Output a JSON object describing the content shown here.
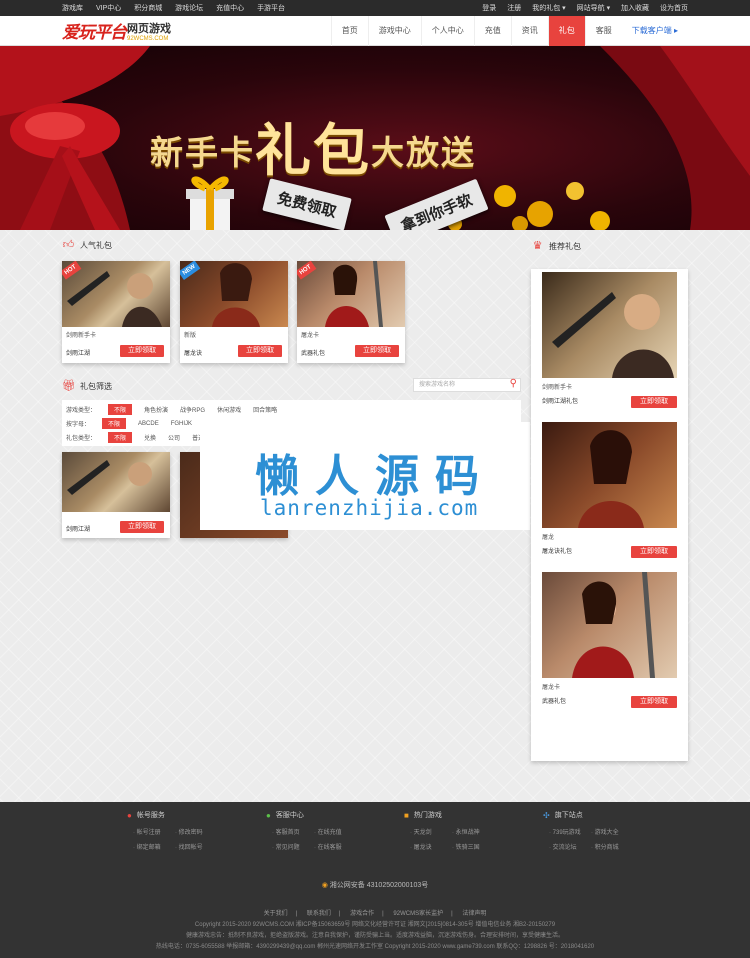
{
  "topbar": {
    "left": [
      "游戏库",
      "VIP中心",
      "积分商城",
      "游戏论坛",
      "充值中心",
      "手游平台"
    ],
    "right": [
      "登录",
      "注册",
      "我的礼包 ▾",
      "网站导航 ▾",
      "加入收藏",
      "设为首页"
    ]
  },
  "logo": {
    "main": "爱玩平台",
    "sub": "网页游戏",
    "domain": "92WCMS.COM"
  },
  "nav": {
    "items": [
      "首页",
      "游戏中心",
      "个人中心",
      "充值",
      "资讯",
      "礼包",
      "客服"
    ],
    "active_index": 5,
    "download": "下载客户端 ▸"
  },
  "banner": {
    "title_left": "新手卡",
    "title_big": "礼包",
    "title_right": "大放送",
    "tag1": "免费领取",
    "tag2": "拿到你手软"
  },
  "popular": {
    "title": "人气礼包",
    "cards": [
      {
        "badge": "HOT",
        "name": "剑雨新手卡",
        "sub": "剑雨江湖",
        "button": "立即领取"
      },
      {
        "badge": "NEW",
        "name": "新版",
        "sub": "屠龙诀",
        "button": "立即领取"
      },
      {
        "badge": "HOT",
        "name": "屠龙卡",
        "sub": "武器礼包",
        "button": "立即领取"
      }
    ]
  },
  "filter": {
    "title": "礼包筛选",
    "search_placeholder": "搜索游戏名称",
    "rows": [
      {
        "label": "游戏类型：",
        "options": [
          "不限",
          "角色扮演",
          "战争RPG",
          "休闲游戏",
          "回合策略"
        ]
      },
      {
        "label": "按字母：",
        "options": [
          "不限",
          "ABCDE",
          "FGHIJK"
        ]
      },
      {
        "label": "礼包类型：",
        "options": [
          "不限",
          "兑换",
          "公司",
          "普通"
        ]
      }
    ],
    "card": {
      "name": "剑雨江湖",
      "button": "立即领取"
    }
  },
  "recommend": {
    "title": "推荐礼包",
    "cards": [
      {
        "name": "剑雨新手卡",
        "sub": "剑雨江湖礼包",
        "button": "立即领取"
      },
      {
        "name": "屠龙",
        "sub": "屠龙诀礼包",
        "button": "立即领取"
      },
      {
        "name": "屠龙卡",
        "sub": "武器礼包",
        "button": "立即领取"
      }
    ]
  },
  "watermark": {
    "cn": "懒人源码",
    "en": "lanrenzhijia.com"
  },
  "footer": {
    "cols": [
      {
        "title": "帐号服务",
        "links": [
          "帐号注册",
          "修改密码",
          "绑定邮箱",
          "找回帐号"
        ]
      },
      {
        "title": "客服中心",
        "links": [
          "客服首页",
          "在线充值",
          "常见问题",
          "在线客服"
        ]
      },
      {
        "title": "热门游戏",
        "links": [
          "天龙剑",
          "永恒战神",
          "屠龙诀",
          "铁骑三国"
        ]
      },
      {
        "title": "旗下站点",
        "links": [
          "739玩游戏",
          "游戏大全",
          "交流论坛",
          "积分商城"
        ]
      }
    ],
    "beian": "湘公网安备 43102502000103号",
    "links": [
      "关于我们",
      "联系我们",
      "游戏合作",
      "92WCMS家长监护",
      "法律声明"
    ],
    "line1": "Copyright 2015-2020 92WCMS.COM 湘ICP备15063659号 网络文化经营许可证 湘网文[2015]0814-305号 增值电信业务 湘B2-20150279",
    "line2": "健康游戏忠告：抵制不良游戏，拒绝盗版游戏。注意自我保护，谨防受骗上当。适度游戏益脑，沉迷游戏伤身。合理安排时间，享受健康生活。",
    "line3": "热线电话：0735-6055588 举报邮箱：4390299439@qq.com 郴州光速网络开发工作室 Copyright 2015-2020 www.game739.com 联系QQ：1298826 号：2018041620"
  }
}
